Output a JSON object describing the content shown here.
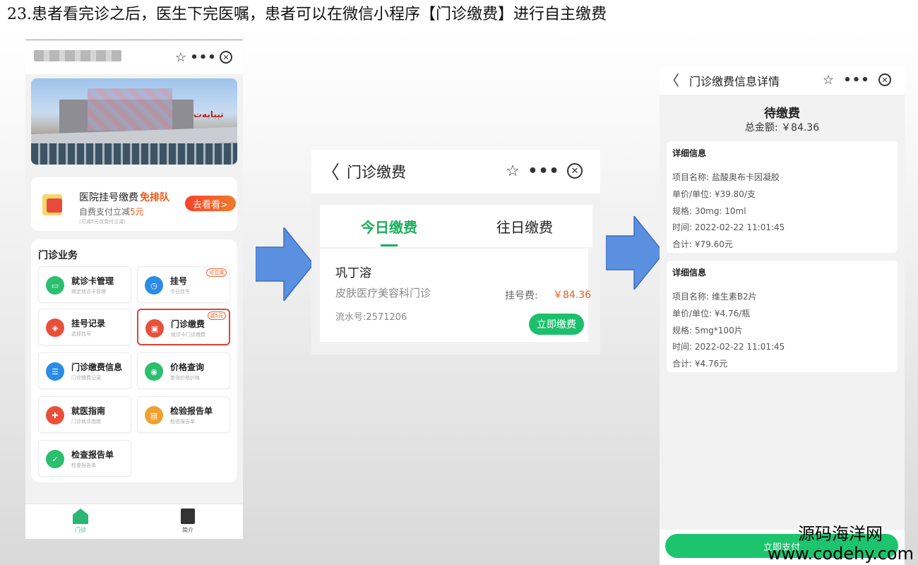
{
  "caption": "23.患者看完诊之后，医生下完医嘱，患者可以在微信小程序【门诊缴费】进行自主缴费",
  "phone1": {
    "banner_sign": "ﺗﯧﺒﺎﺑﻪﺕ",
    "promo": {
      "title": "医院挂号缴费",
      "free": "免排队",
      "sub_prefix": "自费支付立减",
      "sub_amount": "5元",
      "fine": "(可减5元改变付立减)",
      "button": "去看看>"
    },
    "services_title": "门诊业务",
    "services": [
      {
        "label": "就诊卡管理",
        "sub": "绑定就诊卡管理",
        "icon": "card-icon",
        "color": "#2bbf6e",
        "tag": ""
      },
      {
        "label": "挂号",
        "sub": "今日挂号",
        "icon": "clock-icon",
        "color": "#2b8ce6",
        "tag": "可立减"
      },
      {
        "label": "挂号记录",
        "sub": "选择挂号",
        "icon": "shield-icon",
        "color": "#e8503a",
        "tag": ""
      },
      {
        "label": "门诊缴费",
        "sub": "就诊卡门诊缴费",
        "icon": "wallet-icon",
        "color": "#e8503a",
        "tag": "减5元"
      },
      {
        "label": "门诊缴费信息",
        "sub": "门诊缴费记录",
        "icon": "list-icon",
        "color": "#2b8ce6",
        "tag": ""
      },
      {
        "label": "价格查询",
        "sub": "查询价格价格",
        "icon": "price-icon",
        "color": "#2bbf6e",
        "tag": ""
      },
      {
        "label": "就医指南",
        "sub": "门诊就诊指南",
        "icon": "guide-icon",
        "color": "#e8503a",
        "tag": ""
      },
      {
        "label": "检验报告单",
        "sub": "检验报告单",
        "icon": "report-icon",
        "color": "#f0a030",
        "tag": ""
      },
      {
        "label": "检查报告单",
        "sub": "检查报告单",
        "icon": "check-report-icon",
        "color": "#2bbf6e",
        "tag": ""
      }
    ],
    "tabs": [
      {
        "label": "门诊"
      },
      {
        "label": "简介"
      }
    ]
  },
  "phone2": {
    "title": "门诊缴费",
    "tab_today": "今日缴费",
    "tab_past": "往日缴费",
    "patient_name": "巩丁溶",
    "department": "皮肤医疗美容科门诊",
    "serial": "流水号:2571206",
    "fee_label": "挂号费:",
    "fee_value": "￥84.36",
    "pay_button": "立即缴费"
  },
  "phone3": {
    "title": "门诊缴费信息详情",
    "status": "待缴费",
    "total": "总金额: ￥84.36",
    "cards": [
      {
        "header": "详细信息",
        "rows": [
          "项目名称:  盐酸奥布卡因凝胶",
          "单价/单位: ¥39.80/支",
          "规格:  30mg:  10ml",
          "时间:  2022-02-22 11:01:45",
          "合计: ¥79.60元"
        ]
      },
      {
        "header": "详细信息",
        "rows": [
          "项目名称:  维生素B2片",
          "单价/单位: ¥4.76/瓶",
          "规格:  5mg*100片",
          "时间:  2022-02-22 11:01:45",
          "合计: ¥4.76元"
        ]
      }
    ],
    "pay_button": "立即支付"
  },
  "watermark": {
    "line1": "源码海洋网",
    "line2": "www.codehy.com"
  }
}
